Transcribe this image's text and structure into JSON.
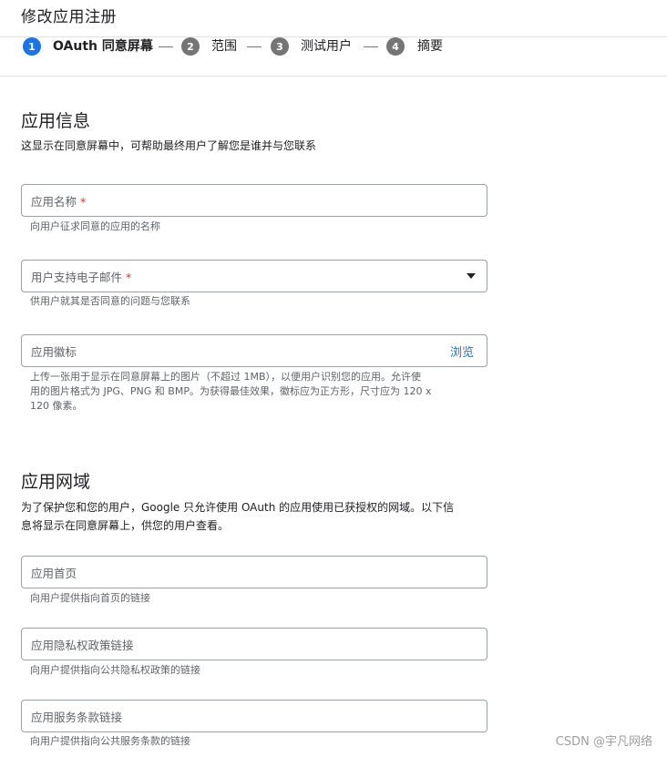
{
  "header": {
    "title": "修改应用注册"
  },
  "stepper": {
    "steps": [
      {
        "number": "1",
        "label": "OAuth 同意屏幕"
      },
      {
        "number": "2",
        "label": "范围"
      },
      {
        "number": "3",
        "label": "测试用户"
      },
      {
        "number": "4",
        "label": "摘要"
      }
    ]
  },
  "app_info": {
    "title": "应用信息",
    "description": "这显示在同意屏幕中，可帮助最终用户了解您是谁并与您联系",
    "app_name": {
      "label": "应用名称",
      "required_mark": "*",
      "value": "",
      "helper": "向用户征求同意的应用的名称"
    },
    "support_email": {
      "label": "用户支持电子邮件",
      "required_mark": "*",
      "value": "",
      "helper": "供用户就其是否同意的问题与您联系"
    },
    "app_logo": {
      "label": "应用徽标",
      "action": "浏览",
      "helper_line1": "上传一张用于显示在同意屏幕上的图片（不超过 1MB），以便用户识别您的应用。允许使",
      "helper_line2": "用的图片格式为 JPG、PNG 和 BMP。为获得最佳效果，徽标应为正方形，尺寸应为 120 x",
      "helper_line3": "120 像素。"
    }
  },
  "app_domain": {
    "title": "应用网域",
    "description_line1": "为了保护您和您的用户，Google 只允许使用 OAuth 的应用使用已获授权的网域。以下信",
    "description_line2": "息将显示在同意屏幕上，供您的用户查看。",
    "homepage": {
      "label": "应用首页",
      "value": "",
      "helper": "向用户提供指向首页的链接"
    },
    "privacy": {
      "label": "应用隐私权政策链接",
      "value": "",
      "helper": "向用户提供指向公共隐私权政策的链接"
    },
    "terms": {
      "label": "应用服务条款链接",
      "value": "",
      "helper": "向用户提供指向公共服务条款的链接"
    }
  },
  "watermark": "CSDN @宇凡网络",
  "colors": {
    "accent": "#1a73e8",
    "required": "#d93025",
    "border": "#9aa0a6"
  },
  "icons": {
    "dropdown": "triangle-down-icon"
  }
}
